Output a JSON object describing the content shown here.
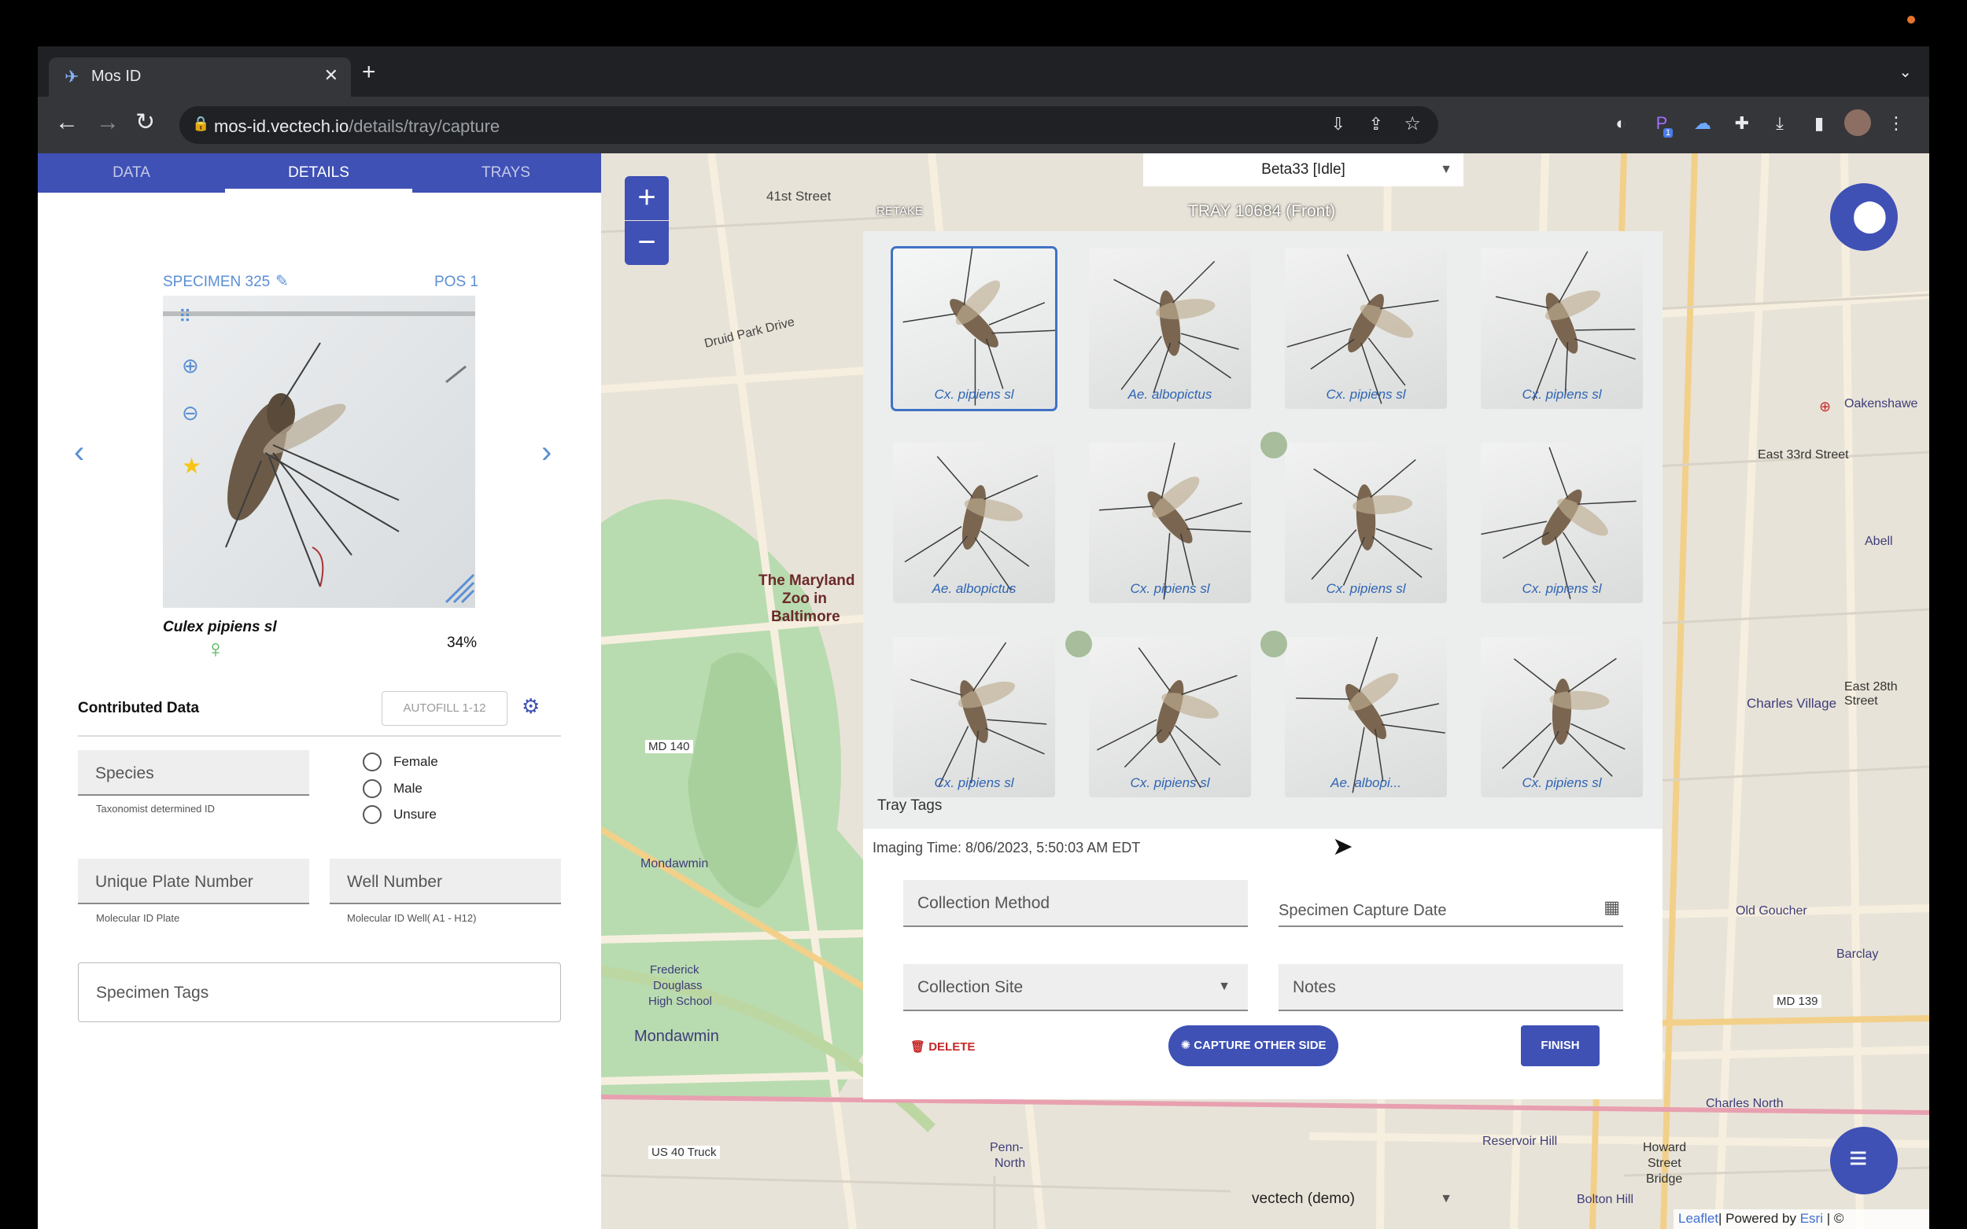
{
  "browser": {
    "tab_title": "Mos ID",
    "url_host": "mos-id.vectech.io",
    "url_path": "/details/tray/capture",
    "extension_badge": "1"
  },
  "nav_tabs": [
    "DATA",
    "DETAILS",
    "TRAYS"
  ],
  "specimen": {
    "title": "SPECIMEN 325",
    "position": "POS 1",
    "species": "Culex pipiens sl",
    "confidence": "34%",
    "sex_symbol": "♀"
  },
  "contributed": {
    "heading": "Contributed Data",
    "autofill_label": "AUTOFILL 1-12",
    "species_label": "Species",
    "species_help": "Taxonomist determined ID",
    "sex_options": [
      "Female",
      "Male",
      "Unsure"
    ],
    "plate_label": "Unique Plate Number",
    "plate_help": "Molecular ID Plate",
    "well_label": "Well Number",
    "well_help": "Molecular ID Well( A1 - H12)",
    "tags_label": "Specimen Tags"
  },
  "map": {
    "device_select": "Beta33 [Idle]",
    "org_select": "vectech (demo)",
    "retake_label": "RETAKE",
    "tray_title": "TRAY 10684 (Front)",
    "zoom_in": "+",
    "zoom_out": "−",
    "attribution": {
      "leaflet": "Leaflet",
      "powered": "| Powered by ",
      "esri": "Esri",
      "osm": " | © OpenStreetMap,"
    },
    "labels": [
      {
        "text": "41st Street"
      },
      {
        "text": "Druid Park Drive"
      },
      {
        "text": "The Maryland"
      },
      {
        "text": "Zoo in"
      },
      {
        "text": "Baltimore"
      },
      {
        "text": "MD 140"
      },
      {
        "text": "Mondawmin"
      },
      {
        "text": "Penn-"
      },
      {
        "text": "North"
      },
      {
        "text": "US 40 Truck"
      },
      {
        "text": "East 33rd Street"
      },
      {
        "text": "Charles Village"
      },
      {
        "text": "Oakenshawe"
      },
      {
        "text": "Abell"
      },
      {
        "text": "East 28th Street"
      },
      {
        "text": "Old Goucher"
      },
      {
        "text": "Barclay"
      },
      {
        "text": "MD 139"
      },
      {
        "text": "Charles North"
      },
      {
        "text": "Howard"
      },
      {
        "text": "Street"
      },
      {
        "text": "Bridge"
      },
      {
        "text": "Bolton Hill"
      },
      {
        "text": "Mondawmin"
      },
      {
        "text": "Reservoir Hill"
      },
      {
        "text": "Frederick"
      },
      {
        "text": "Douglass"
      },
      {
        "text": "High School"
      }
    ]
  },
  "tray": {
    "tags_label": "Tray Tags",
    "cells": [
      {
        "label": "Cx. pipiens sl",
        "selected": true
      },
      {
        "label": "Ae. albopictus",
        "selected": false
      },
      {
        "label": "Cx. pipiens sl",
        "selected": false
      },
      {
        "label": "Cx. pipiens sl",
        "selected": false
      },
      {
        "label": "Ae. albopictus",
        "selected": false
      },
      {
        "label": "Cx. pipiens sl",
        "selected": false
      },
      {
        "label": "Cx. pipiens sl",
        "selected": false
      },
      {
        "label": "Cx. pipiens sl",
        "selected": false
      },
      {
        "label": "Cx. pipiens sl",
        "selected": false
      },
      {
        "label": "Cx. pipiens sl",
        "selected": false
      },
      {
        "label": "Ae. albopi...",
        "selected": false
      },
      {
        "label": "Cx. pipiens sl",
        "selected": false
      }
    ]
  },
  "capture_form": {
    "imaging_time": "Imaging Time: 8/06/2023, 5:50:03 AM EDT",
    "collection_method": "Collection Method",
    "capture_date": "Specimen Capture Date",
    "collection_site": "Collection Site",
    "notes": "Notes",
    "delete_label": "DELETE",
    "capture_other_label": "CAPTURE OTHER SIDE",
    "finish_label": "FINISH"
  },
  "colors": {
    "primary": "#3f51b5",
    "link": "#5b8fd4",
    "danger": "#c62828",
    "star": "#f5c518"
  }
}
